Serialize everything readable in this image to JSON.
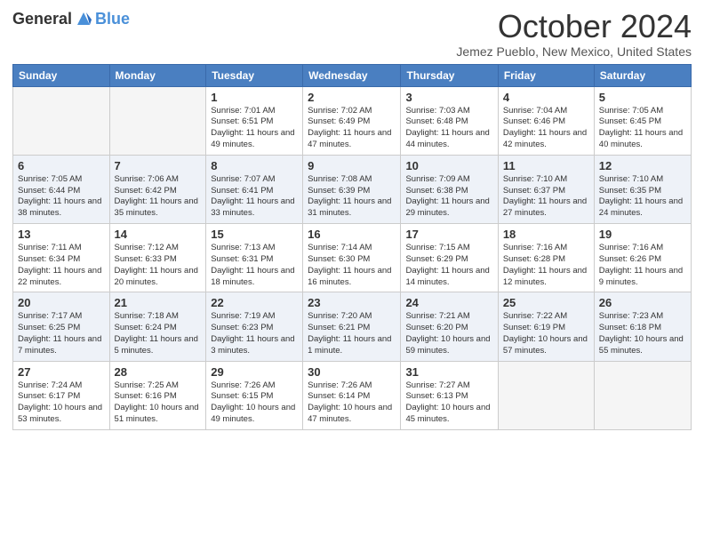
{
  "header": {
    "logo": {
      "general": "General",
      "blue": "Blue"
    },
    "title": "October 2024",
    "location": "Jemez Pueblo, New Mexico, United States"
  },
  "weekdays": [
    "Sunday",
    "Monday",
    "Tuesday",
    "Wednesday",
    "Thursday",
    "Friday",
    "Saturday"
  ],
  "weeks": [
    [
      {
        "day": "",
        "sunrise": "",
        "sunset": "",
        "daylight": ""
      },
      {
        "day": "",
        "sunrise": "",
        "sunset": "",
        "daylight": ""
      },
      {
        "day": "1",
        "sunrise": "Sunrise: 7:01 AM",
        "sunset": "Sunset: 6:51 PM",
        "daylight": "Daylight: 11 hours and 49 minutes."
      },
      {
        "day": "2",
        "sunrise": "Sunrise: 7:02 AM",
        "sunset": "Sunset: 6:49 PM",
        "daylight": "Daylight: 11 hours and 47 minutes."
      },
      {
        "day": "3",
        "sunrise": "Sunrise: 7:03 AM",
        "sunset": "Sunset: 6:48 PM",
        "daylight": "Daylight: 11 hours and 44 minutes."
      },
      {
        "day": "4",
        "sunrise": "Sunrise: 7:04 AM",
        "sunset": "Sunset: 6:46 PM",
        "daylight": "Daylight: 11 hours and 42 minutes."
      },
      {
        "day": "5",
        "sunrise": "Sunrise: 7:05 AM",
        "sunset": "Sunset: 6:45 PM",
        "daylight": "Daylight: 11 hours and 40 minutes."
      }
    ],
    [
      {
        "day": "6",
        "sunrise": "Sunrise: 7:05 AM",
        "sunset": "Sunset: 6:44 PM",
        "daylight": "Daylight: 11 hours and 38 minutes."
      },
      {
        "day": "7",
        "sunrise": "Sunrise: 7:06 AM",
        "sunset": "Sunset: 6:42 PM",
        "daylight": "Daylight: 11 hours and 35 minutes."
      },
      {
        "day": "8",
        "sunrise": "Sunrise: 7:07 AM",
        "sunset": "Sunset: 6:41 PM",
        "daylight": "Daylight: 11 hours and 33 minutes."
      },
      {
        "day": "9",
        "sunrise": "Sunrise: 7:08 AM",
        "sunset": "Sunset: 6:39 PM",
        "daylight": "Daylight: 11 hours and 31 minutes."
      },
      {
        "day": "10",
        "sunrise": "Sunrise: 7:09 AM",
        "sunset": "Sunset: 6:38 PM",
        "daylight": "Daylight: 11 hours and 29 minutes."
      },
      {
        "day": "11",
        "sunrise": "Sunrise: 7:10 AM",
        "sunset": "Sunset: 6:37 PM",
        "daylight": "Daylight: 11 hours and 27 minutes."
      },
      {
        "day": "12",
        "sunrise": "Sunrise: 7:10 AM",
        "sunset": "Sunset: 6:35 PM",
        "daylight": "Daylight: 11 hours and 24 minutes."
      }
    ],
    [
      {
        "day": "13",
        "sunrise": "Sunrise: 7:11 AM",
        "sunset": "Sunset: 6:34 PM",
        "daylight": "Daylight: 11 hours and 22 minutes."
      },
      {
        "day": "14",
        "sunrise": "Sunrise: 7:12 AM",
        "sunset": "Sunset: 6:33 PM",
        "daylight": "Daylight: 11 hours and 20 minutes."
      },
      {
        "day": "15",
        "sunrise": "Sunrise: 7:13 AM",
        "sunset": "Sunset: 6:31 PM",
        "daylight": "Daylight: 11 hours and 18 minutes."
      },
      {
        "day": "16",
        "sunrise": "Sunrise: 7:14 AM",
        "sunset": "Sunset: 6:30 PM",
        "daylight": "Daylight: 11 hours and 16 minutes."
      },
      {
        "day": "17",
        "sunrise": "Sunrise: 7:15 AM",
        "sunset": "Sunset: 6:29 PM",
        "daylight": "Daylight: 11 hours and 14 minutes."
      },
      {
        "day": "18",
        "sunrise": "Sunrise: 7:16 AM",
        "sunset": "Sunset: 6:28 PM",
        "daylight": "Daylight: 11 hours and 12 minutes."
      },
      {
        "day": "19",
        "sunrise": "Sunrise: 7:16 AM",
        "sunset": "Sunset: 6:26 PM",
        "daylight": "Daylight: 11 hours and 9 minutes."
      }
    ],
    [
      {
        "day": "20",
        "sunrise": "Sunrise: 7:17 AM",
        "sunset": "Sunset: 6:25 PM",
        "daylight": "Daylight: 11 hours and 7 minutes."
      },
      {
        "day": "21",
        "sunrise": "Sunrise: 7:18 AM",
        "sunset": "Sunset: 6:24 PM",
        "daylight": "Daylight: 11 hours and 5 minutes."
      },
      {
        "day": "22",
        "sunrise": "Sunrise: 7:19 AM",
        "sunset": "Sunset: 6:23 PM",
        "daylight": "Daylight: 11 hours and 3 minutes."
      },
      {
        "day": "23",
        "sunrise": "Sunrise: 7:20 AM",
        "sunset": "Sunset: 6:21 PM",
        "daylight": "Daylight: 11 hours and 1 minute."
      },
      {
        "day": "24",
        "sunrise": "Sunrise: 7:21 AM",
        "sunset": "Sunset: 6:20 PM",
        "daylight": "Daylight: 10 hours and 59 minutes."
      },
      {
        "day": "25",
        "sunrise": "Sunrise: 7:22 AM",
        "sunset": "Sunset: 6:19 PM",
        "daylight": "Daylight: 10 hours and 57 minutes."
      },
      {
        "day": "26",
        "sunrise": "Sunrise: 7:23 AM",
        "sunset": "Sunset: 6:18 PM",
        "daylight": "Daylight: 10 hours and 55 minutes."
      }
    ],
    [
      {
        "day": "27",
        "sunrise": "Sunrise: 7:24 AM",
        "sunset": "Sunset: 6:17 PM",
        "daylight": "Daylight: 10 hours and 53 minutes."
      },
      {
        "day": "28",
        "sunrise": "Sunrise: 7:25 AM",
        "sunset": "Sunset: 6:16 PM",
        "daylight": "Daylight: 10 hours and 51 minutes."
      },
      {
        "day": "29",
        "sunrise": "Sunrise: 7:26 AM",
        "sunset": "Sunset: 6:15 PM",
        "daylight": "Daylight: 10 hours and 49 minutes."
      },
      {
        "day": "30",
        "sunrise": "Sunrise: 7:26 AM",
        "sunset": "Sunset: 6:14 PM",
        "daylight": "Daylight: 10 hours and 47 minutes."
      },
      {
        "day": "31",
        "sunrise": "Sunrise: 7:27 AM",
        "sunset": "Sunset: 6:13 PM",
        "daylight": "Daylight: 10 hours and 45 minutes."
      },
      {
        "day": "",
        "sunrise": "",
        "sunset": "",
        "daylight": ""
      },
      {
        "day": "",
        "sunrise": "",
        "sunset": "",
        "daylight": ""
      }
    ]
  ]
}
